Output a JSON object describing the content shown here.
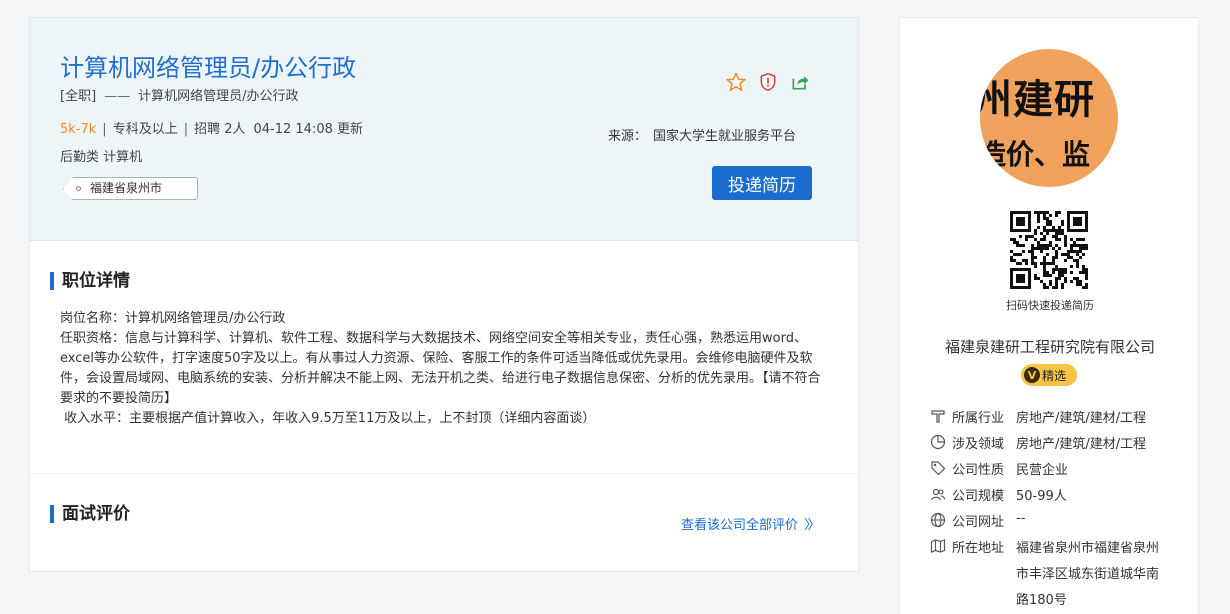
{
  "job": {
    "title": "计算机网络管理员/办公行政",
    "type": "[全职]",
    "dash": "——",
    "subtitle": "计算机网络管理员/办公行政",
    "salary": "5k-7k",
    "education": "专科及以上",
    "headcount": "招聘 2人",
    "updated": "04-12 14:08 更新",
    "category": "后勤类 计算机",
    "location": "福建省泉州市",
    "source_label": "来源：",
    "source": "国家大学生就业服务平台",
    "apply_label": "投递简历"
  },
  "detail": {
    "title": "职位详情",
    "lines": [
      "岗位名称：计算机网络管理员/办公行政",
      "任职资格：信息与计算科学、计算机、软件工程、数据科学与大数据技术、网络空间安全等相关专业，责任心强，熟悉运用word、excel等办公软件，打字速度50字及以上。有从事过人力资源、保险、客服工作的条件可适当降低或优先录用。会维修电脑硬件及软件，会设置局域网、电脑系统的安装、分析并解决不能上网、无法开机之类、给进行电子数据信息保密、分析的优先录用。【请不符合要求的不要投简历】",
      " 收入水平：主要根据产值计算收入，年收入9.5万至11万及以上，上不封顶（详细内容面谈）"
    ]
  },
  "review": {
    "title": "面试评价",
    "link": "查看该公司全部评价"
  },
  "company": {
    "logo_line1": "州建研",
    "logo_line2": "造价、监",
    "qr_caption": "扫码快速投递简历",
    "name": "福建泉建研工程研究院有限公司",
    "badge_v": "V",
    "badge": "精选",
    "info": [
      {
        "icon": "industry-icon",
        "label": "所属行业",
        "value": "房地产/建筑/建材/工程"
      },
      {
        "icon": "pie-chart-icon",
        "label": "涉及领域",
        "value": "房地产/建筑/建材/工程"
      },
      {
        "icon": "tag-icon",
        "label": "公司性质",
        "value": "民营企业"
      },
      {
        "icon": "people-icon",
        "label": "公司规模",
        "value": "50-99人"
      },
      {
        "icon": "globe-icon",
        "label": "公司网址",
        "value": "--"
      },
      {
        "icon": "map-icon",
        "label": "所在地址",
        "value": ""
      }
    ],
    "address": "福建省泉州市福建省泉州市丰泽区城东街道城华南路180号"
  },
  "colors": {
    "accent": "#1a6dce",
    "salary": "#f08a24",
    "badge": "#f6c443",
    "star": "#f08a24",
    "report": "#e0383e",
    "share": "#2fa84f"
  }
}
